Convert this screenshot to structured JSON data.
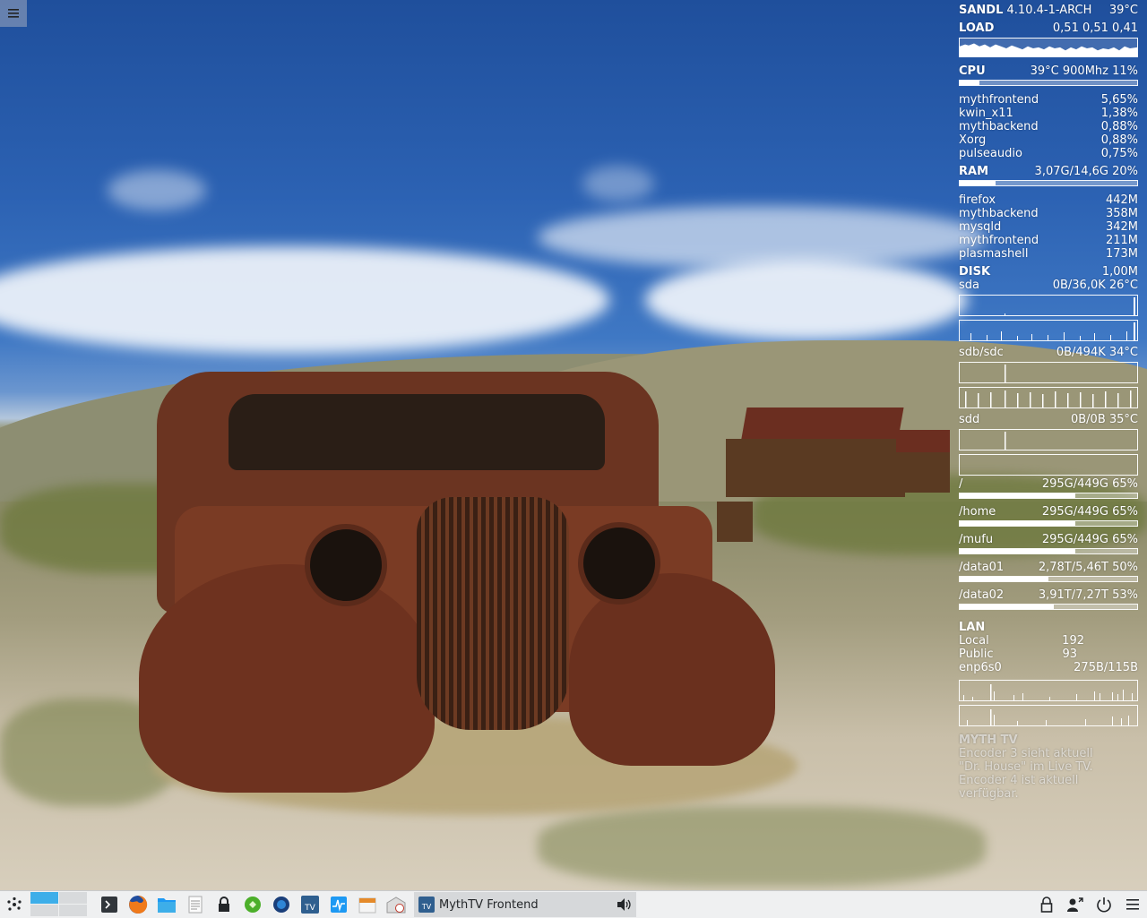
{
  "desktop": {
    "menu_button_icon": "hamburger-icon"
  },
  "conky": {
    "header": {
      "host": "SANDL",
      "kernel": "4.10.4-1-ARCH",
      "temp": "39°C"
    },
    "load": {
      "label": "LOAD",
      "value": "0,51 0,51 0,41"
    },
    "cpu": {
      "label": "CPU",
      "value": "39°C 900Mhz 11%",
      "usage_percent": 11
    },
    "cpu_processes": [
      {
        "name": "mythfrontend",
        "value": "5,65%"
      },
      {
        "name": "kwin_x11",
        "value": "1,38%"
      },
      {
        "name": "mythbackend",
        "value": "0,88%"
      },
      {
        "name": "Xorg",
        "value": "0,88%"
      },
      {
        "name": "pulseaudio",
        "value": "0,75%"
      }
    ],
    "ram": {
      "label": "RAM",
      "value": "3,07G/14,6G 20%",
      "usage_percent": 20
    },
    "ram_processes": [
      {
        "name": "firefox",
        "value": "442M"
      },
      {
        "name": "mythbackend",
        "value": "358M"
      },
      {
        "name": "mysqld",
        "value": "342M"
      },
      {
        "name": "mythfrontend",
        "value": "211M"
      },
      {
        "name": "plasmashell",
        "value": "173M"
      }
    ],
    "disk": {
      "label": "DISK",
      "value": "1,00M"
    },
    "drives": [
      {
        "name": "sda",
        "value": "0B/36,0K 26°C"
      },
      {
        "name": "sdb/sdc",
        "value": "0B/494K 34°C"
      },
      {
        "name": "sdd",
        "value": "0B/0B 35°C"
      }
    ],
    "filesystems": [
      {
        "name": "/",
        "value": "295G/449G 65%",
        "usage_percent": 65
      },
      {
        "name": "/home",
        "value": "295G/449G 65%",
        "usage_percent": 65
      },
      {
        "name": "/mufu",
        "value": "295G/449G 65%",
        "usage_percent": 65
      },
      {
        "name": "/data01",
        "value": "2,78T/5,46T 50%",
        "usage_percent": 50
      },
      {
        "name": "/data02",
        "value": "3,91T/7,27T 53%",
        "usage_percent": 53
      }
    ],
    "lan": {
      "label": "LAN",
      "local_label": "Local",
      "local_value": "192",
      "public_label": "Public",
      "public_value": "93",
      "iface_label": "enp6s0",
      "iface_value": "275B/115B"
    },
    "myth": {
      "label": "MYTH TV",
      "lines": [
        "Encoder 3 sieht aktuell",
        "\"Dr. House\" im Live TV.",
        "Encoder 4 ist aktuell",
        "verfügbar."
      ]
    }
  },
  "taskbar": {
    "launcher_icon": "app-launcher-icon",
    "quicklaunch": [
      "terminal-icon",
      "firefox-icon",
      "file-manager-icon",
      "text-editor-icon",
      "lock-icon",
      "network-icon",
      "browser-icon",
      "mythtv-icon",
      "system-monitor-icon",
      "calendar-icon",
      "mail-icon"
    ],
    "task": {
      "label": "MythTV Frontend",
      "icon": "mythtv-icon"
    },
    "tray": [
      "lock-icon",
      "user-switch-icon",
      "power-icon",
      "menu-icon"
    ],
    "colors": {
      "accent": "#3daee9",
      "panel": "#eff0f1"
    }
  }
}
